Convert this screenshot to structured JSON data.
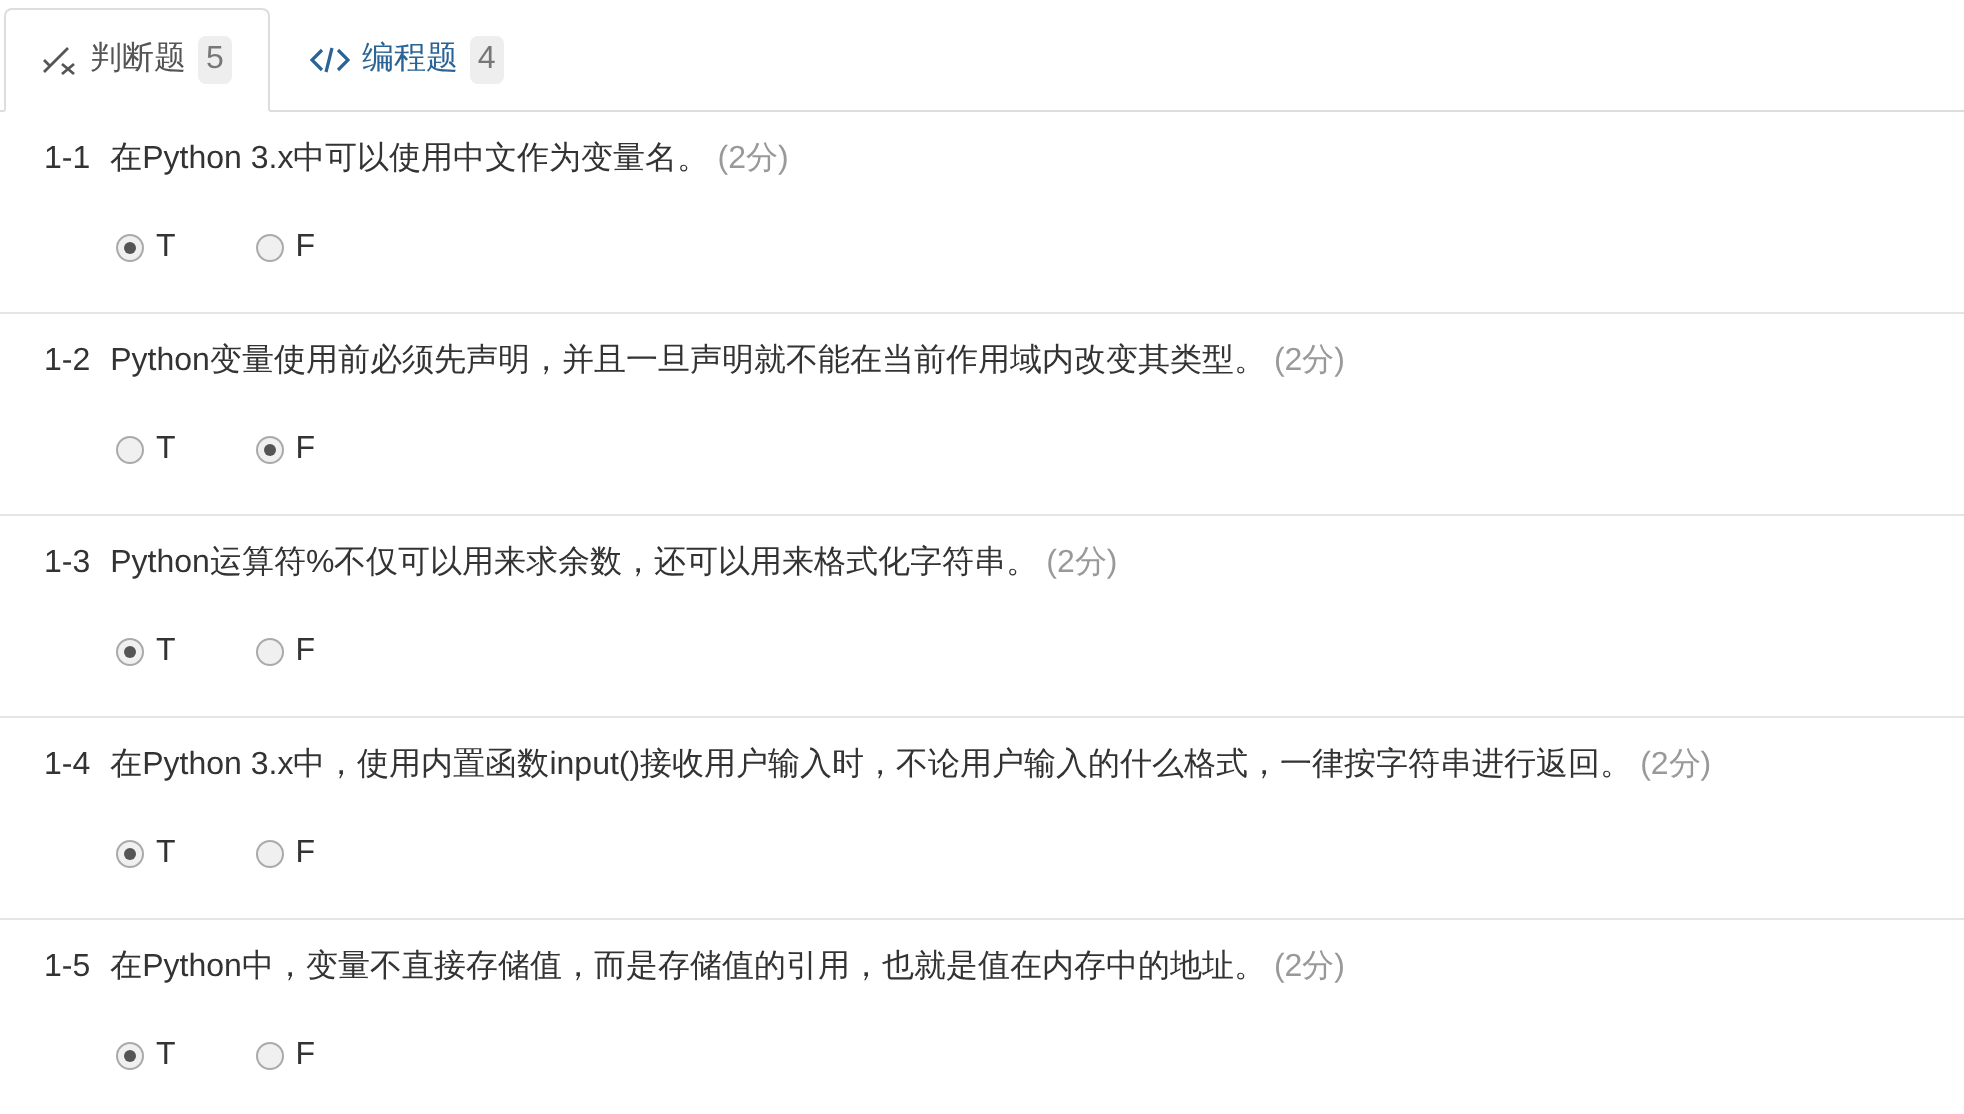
{
  "tabs": [
    {
      "kind": "judge",
      "label": "判断题",
      "count": "5",
      "selected": true
    },
    {
      "kind": "code",
      "label": "编程题",
      "count": "4",
      "selected": false
    }
  ],
  "questions": [
    {
      "number": "1-1",
      "text": "在Python 3.x中可以使用中文作为变量名。",
      "score": "(2分)",
      "options": [
        {
          "label": "T",
          "selected": true
        },
        {
          "label": "F",
          "selected": false
        }
      ]
    },
    {
      "number": "1-2",
      "text": "Python变量使用前必须先声明，并且一旦声明就不能在当前作用域内改变其类型。",
      "score": "(2分)",
      "options": [
        {
          "label": "T",
          "selected": false
        },
        {
          "label": "F",
          "selected": true
        }
      ]
    },
    {
      "number": "1-3",
      "text": "Python运算符%不仅可以用来求余数，还可以用来格式化字符串。",
      "score": "(2分)",
      "options": [
        {
          "label": "T",
          "selected": true
        },
        {
          "label": "F",
          "selected": false
        }
      ]
    },
    {
      "number": "1-4",
      "text": "在Python 3.x中，使用内置函数input()接收用户输入时，不论用户输入的什么格式，一律按字符串进行返回。",
      "score": "(2分)",
      "options": [
        {
          "label": "T",
          "selected": true
        },
        {
          "label": "F",
          "selected": false
        }
      ]
    },
    {
      "number": "1-5",
      "text": "在Python中，变量不直接存储值，而是存储值的引用，也就是值在内存中的地址。",
      "score": "(2分)",
      "options": [
        {
          "label": "T",
          "selected": true
        },
        {
          "label": "F",
          "selected": false
        }
      ]
    }
  ]
}
